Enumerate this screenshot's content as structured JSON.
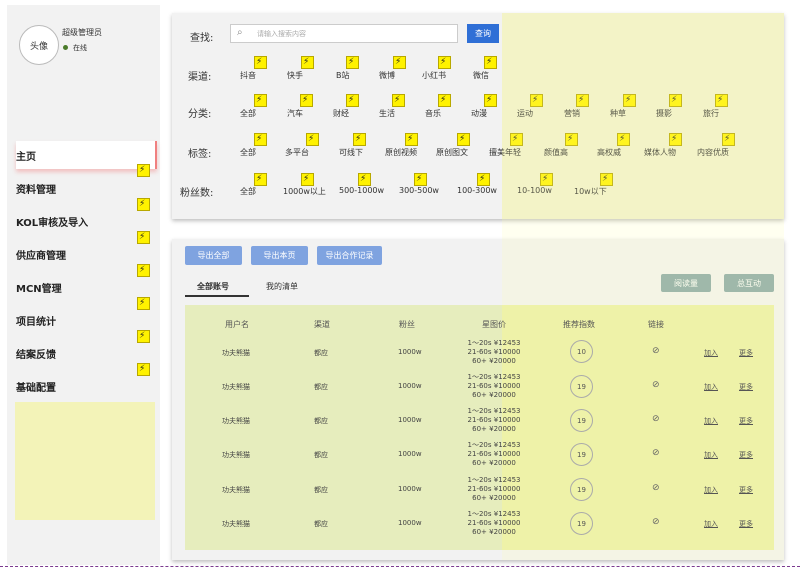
{
  "user": {
    "avatar_text": "头像",
    "name": "超级管理员",
    "status": "在线"
  },
  "nav": [
    {
      "label": "主页"
    },
    {
      "label": "资料管理"
    },
    {
      "label": "KOL审核及导入"
    },
    {
      "label": "供应商管理"
    },
    {
      "label": "MCN管理"
    },
    {
      "label": "项目统计"
    },
    {
      "label": "结案反馈"
    },
    {
      "label": "基础配置"
    }
  ],
  "search": {
    "label": "查找:",
    "placeholder": "请输入搜索内容",
    "button": "查询"
  },
  "filters": {
    "channel": {
      "label": "渠道:",
      "options": [
        "抖音",
        "快手",
        "B站",
        "微博",
        "小红书",
        "微信"
      ]
    },
    "category": {
      "label": "分类:",
      "options": [
        "全部",
        "汽车",
        "财经",
        "生活",
        "音乐",
        "动漫",
        "运动",
        "营销",
        "种草",
        "摄影",
        "旅行"
      ]
    },
    "tag": {
      "label": "标签:",
      "options": [
        "全部",
        "多平台",
        "可线下",
        "原创视频",
        "原创图文",
        "擅美年轻",
        "颜值高",
        "高权威",
        "媒体人物",
        "内容优质"
      ]
    },
    "fans": {
      "label": "粉丝数:",
      "options": [
        "全部",
        "1000w以上",
        "500-1000w",
        "300-500w",
        "100-300w",
        "10-100w",
        "10w以下"
      ]
    }
  },
  "actions": {
    "export_all": "导出全部",
    "export_page": "导出本页",
    "export_history": "导出合作记录",
    "read": "阅读量",
    "interact": "总互动"
  },
  "tabs": {
    "all": "全部账号",
    "mine": "我的清单"
  },
  "table": {
    "headers": [
      "用户名",
      "渠道",
      "粉丝",
      "星图价",
      "推荐指数",
      "链接"
    ],
    "rows": [
      {
        "name": "功夫熊猫",
        "channel": "都应",
        "fans": "1000w",
        "price1": "1～20s ¥12453",
        "price2": "21-60s ¥10000",
        "price3": "60+ ¥20000",
        "score": "10",
        "add": "加入",
        "more": "更多"
      },
      {
        "name": "功夫熊猫",
        "channel": "都应",
        "fans": "1000w",
        "price1": "1～20s ¥12453",
        "price2": "21-60s ¥10000",
        "price3": "60+ ¥20000",
        "score": "19",
        "add": "加入",
        "more": "更多"
      },
      {
        "name": "功夫熊猫",
        "channel": "都应",
        "fans": "1000w",
        "price1": "1～20s ¥12453",
        "price2": "21-60s ¥10000",
        "price3": "60+ ¥20000",
        "score": "19",
        "add": "加入",
        "more": "更多"
      },
      {
        "name": "功夫熊猫",
        "channel": "都应",
        "fans": "1000w",
        "price1": "1～20s ¥12453",
        "price2": "21-60s ¥10000",
        "price3": "60+ ¥20000",
        "score": "19",
        "add": "加入",
        "more": "更多"
      },
      {
        "name": "功夫熊猫",
        "channel": "都应",
        "fans": "1000w",
        "price1": "1～20s ¥12453",
        "price2": "21-60s ¥10000",
        "price3": "60+ ¥20000",
        "score": "19",
        "add": "加入",
        "more": "更多"
      },
      {
        "name": "功夫熊猫",
        "channel": "都应",
        "fans": "1000w",
        "price1": "1～20s ¥12453",
        "price2": "21-60s ¥10000",
        "price3": "60+ ¥20000",
        "score": "19",
        "add": "加入",
        "more": "更多"
      }
    ]
  },
  "colors": {
    "highlight": "#f0f0a0",
    "primary_button": "#2f6fd6",
    "secondary_button": "#7fa3e0",
    "teal_button": "#8aa9aa"
  }
}
